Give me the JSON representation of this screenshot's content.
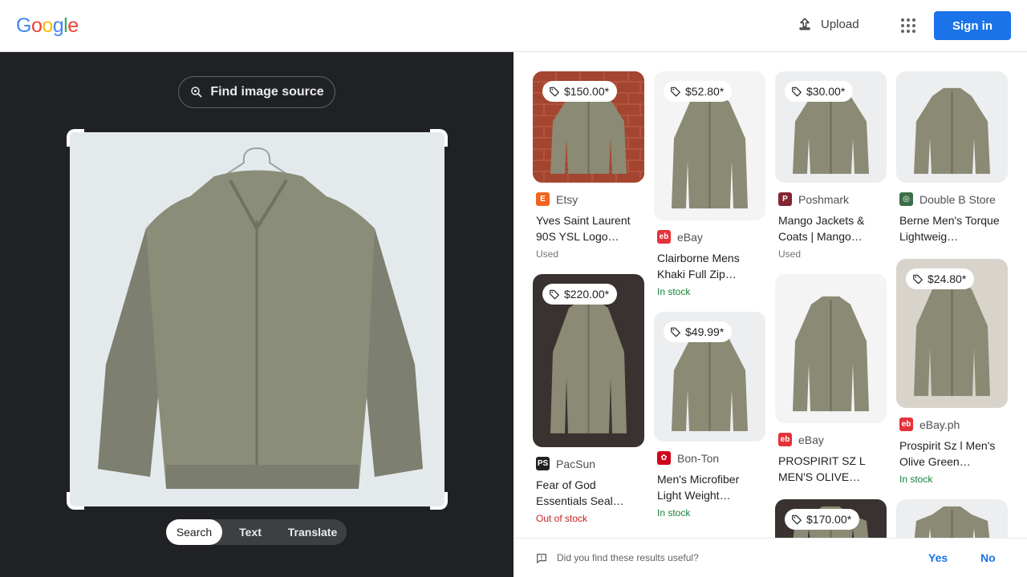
{
  "header": {
    "logo_letters": [
      {
        "ch": "G",
        "color": "#4285f4"
      },
      {
        "ch": "o",
        "color": "#ea4335"
      },
      {
        "ch": "o",
        "color": "#fbbc05"
      },
      {
        "ch": "g",
        "color": "#4285f4"
      },
      {
        "ch": "l",
        "color": "#34a853"
      },
      {
        "ch": "e",
        "color": "#ea4335"
      }
    ],
    "upload_label": "Upload",
    "signin_label": "Sign in"
  },
  "left": {
    "find_source_label": "Find image source",
    "modes": [
      "Search",
      "Text",
      "Translate"
    ],
    "active_mode": "Search"
  },
  "results": [
    {
      "col": 0,
      "price": "$150.00*",
      "source": "Etsy",
      "favicon": "E",
      "favicon_color": "#f1641e",
      "title": "Yves Saint Laurent 90S YSL Logo…",
      "status": "Used",
      "status_type": "gray",
      "thumb_h": 139,
      "bg": "brick"
    },
    {
      "col": 0,
      "price": "$220.00*",
      "source": "PacSun",
      "favicon": "PS",
      "favicon_color": "#202124",
      "title": "Fear of God Essentials Seal…",
      "status": "Out of stock",
      "status_type": "red",
      "thumb_h": 216,
      "bg": "dark"
    },
    {
      "col": 1,
      "price": "$52.80*",
      "source": "eBay",
      "favicon": "eb",
      "favicon_color": "#e53238",
      "title": "Clairborne Mens Khaki Full Zip…",
      "status": "In stock",
      "status_type": "green",
      "thumb_h": 186,
      "bg": "white"
    },
    {
      "col": 1,
      "price": "$49.99*",
      "source": "Bon-Ton",
      "favicon": "✿",
      "favicon_color": "#d0021b",
      "title": "Men's Microfiber Light Weight…",
      "status": "In stock",
      "status_type": "green",
      "thumb_h": 162,
      "bg": "light"
    },
    {
      "col": 2,
      "price": "$30.00*",
      "source": "Poshmark",
      "favicon": "P",
      "favicon_color": "#822432",
      "title": "Mango Jackets & Coats | Mango…",
      "status": "Used",
      "status_type": "gray",
      "thumb_h": 139,
      "bg": "light"
    },
    {
      "col": 2,
      "price": "",
      "source": "eBay",
      "favicon": "eb",
      "favicon_color": "#e53238",
      "title": "PROSPIRIT SZ L MEN'S OLIVE…",
      "status": "",
      "status_type": "gray",
      "thumb_h": 186,
      "bg": "white"
    },
    {
      "col": 2,
      "price": "$170.00*",
      "source": "",
      "favicon": "",
      "favicon_color": "",
      "title": "",
      "status": "",
      "status_type": "gray",
      "thumb_h": 60,
      "bg": "dark"
    },
    {
      "col": 3,
      "price": "",
      "source": "Double B Store",
      "favicon": "◎",
      "favicon_color": "#3c6e47",
      "title": "Berne Men's Torque Lightweig…",
      "status": "",
      "status_type": "gray",
      "thumb_h": 139,
      "bg": "light"
    },
    {
      "col": 3,
      "price": "$24.80*",
      "source": "eBay.ph",
      "favicon": "eb",
      "favicon_color": "#e53238",
      "title": "Prospirit Sz l Men's Olive Green…",
      "status": "In stock",
      "status_type": "green",
      "thumb_h": 186,
      "bg": "wood"
    },
    {
      "col": 3,
      "price": "",
      "source": "",
      "favicon": "",
      "favicon_color": "",
      "title": "",
      "status": "",
      "status_type": "gray",
      "thumb_h": 60,
      "bg": "light"
    }
  ],
  "feedback": {
    "question": "Did you find these results useful?",
    "yes": "Yes",
    "no": "No"
  },
  "colors": {
    "accent": "#1a73e8",
    "dark_panel": "#202124",
    "jacket": "#8a8d78"
  }
}
